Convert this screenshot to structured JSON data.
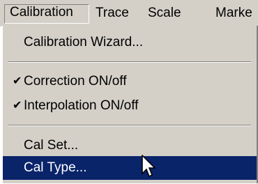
{
  "menubar": {
    "items": [
      {
        "label": "Calibration"
      },
      {
        "label": "Trace"
      },
      {
        "label": "Scale"
      },
      {
        "label": "Marke"
      }
    ]
  },
  "menu": {
    "items": [
      {
        "label": "Calibration Wizard..."
      },
      {
        "label": "Correction ON/off",
        "check": "✔"
      },
      {
        "label": "Interpolation ON/off",
        "check": "✔"
      },
      {
        "label": "Cal Set..."
      },
      {
        "label": "Cal Type..."
      }
    ]
  },
  "colors": {
    "menu_bg": "#d4d0c8",
    "highlight": "#0a246a"
  }
}
